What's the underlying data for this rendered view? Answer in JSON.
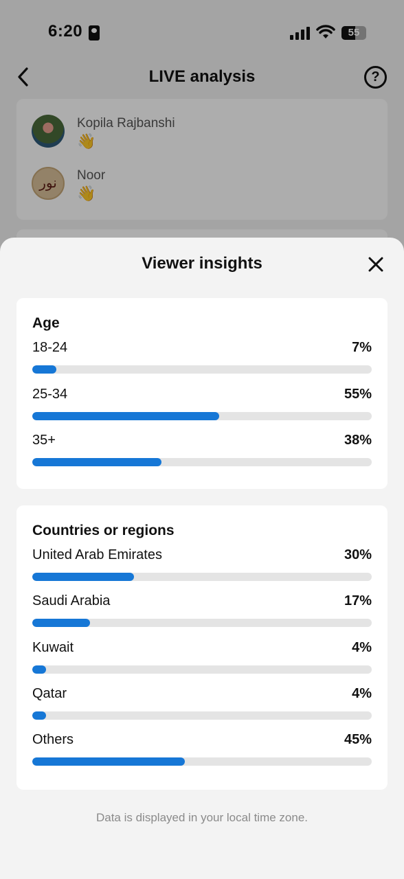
{
  "status_bar": {
    "time": "6:20",
    "battery": "55",
    "battery_fraction": 0.55
  },
  "header": {
    "title": "LIVE analysis"
  },
  "viewers": [
    {
      "name": "Kopila Rajbanshi",
      "emoji": "👋",
      "avatar": "avatar-photo"
    },
    {
      "name": "Noor",
      "emoji": "👋",
      "avatar": "calligraphy-avatar"
    }
  ],
  "sheet": {
    "title": "Viewer insights",
    "age": {
      "title": "Age",
      "rows": [
        {
          "label": "18-24",
          "pct": "7%",
          "value": 0.07
        },
        {
          "label": "25-34",
          "pct": "55%",
          "value": 0.55
        },
        {
          "label": "35+",
          "pct": "38%",
          "value": 0.38
        }
      ]
    },
    "countries": {
      "title": "Countries or regions",
      "rows": [
        {
          "label": "United Arab Emirates",
          "pct": "30%",
          "value": 0.3
        },
        {
          "label": "Saudi Arabia",
          "pct": "17%",
          "value": 0.17
        },
        {
          "label": "Kuwait",
          "pct": "4%",
          "value": 0.04
        },
        {
          "label": "Qatar",
          "pct": "4%",
          "value": 0.04
        },
        {
          "label": "Others",
          "pct": "45%",
          "value": 0.45
        }
      ]
    },
    "footer_note": "Data is displayed in your local time zone."
  },
  "colors": {
    "accent": "#1677d6",
    "track": "#e4e4e4",
    "sheet_bg": "#f3f3f3"
  }
}
